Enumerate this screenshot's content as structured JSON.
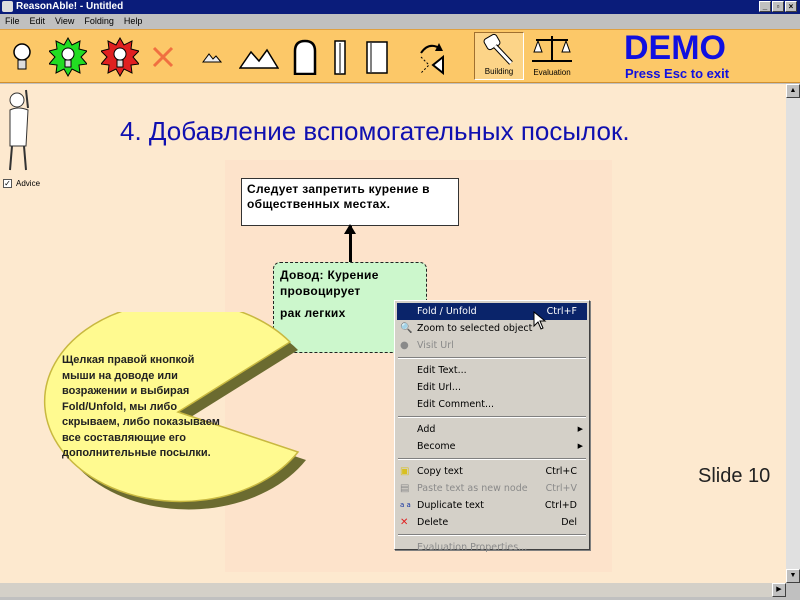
{
  "window": {
    "title": "ReasonAble! - Untitled",
    "buttons": [
      "_",
      "▫",
      "×"
    ]
  },
  "menubar": [
    "File",
    "Edit",
    "View",
    "Folding",
    "Help"
  ],
  "toolbar": {
    "tools": [
      "bulb-icon",
      "bulb-green-icon",
      "bulb-red-icon",
      "delete-x-icon",
      "small-mountains-icon",
      "mountains-icon",
      "tombstone-icon",
      "pillar-icon",
      "scroll-icon",
      "rotate-icon"
    ],
    "modes": [
      {
        "label": "Building",
        "active": true
      },
      {
        "label": "Evaluation",
        "active": false
      }
    ],
    "demo": "DEMO",
    "demo_hint": "Press Esc to exit",
    "accent": "#1010e0"
  },
  "advice": {
    "label": "Advice",
    "checked": true,
    "check": "✓"
  },
  "slide": {
    "title": "4. Добавление вспомогательных посылок.",
    "number": "Slide 10"
  },
  "nodes": {
    "claim": "Следует запретить курение в общественных местах.",
    "reason_line1": "Довод: Курение провоцирует",
    "reason_line2": "рак легких"
  },
  "callout": "Щелкая правой кнопкой мыши на доводе или возражении и выбирая Fold/Unfold, мы либо скрываем, либо показываем все составляющие его дополнительные посылки.",
  "context_menu": {
    "fold": {
      "label": "Fold / Unfold",
      "shortcut": "Ctrl+F"
    },
    "zoom": {
      "label": "Zoom to selected object"
    },
    "visit": {
      "label": "Visit Url"
    },
    "edit_text": "Edit Text...",
    "edit_url": "Edit Url...",
    "edit_comment": "Edit Comment...",
    "add": "Add",
    "become": "Become",
    "copy": {
      "label": "Copy text",
      "shortcut": "Ctrl+C"
    },
    "paste": {
      "label": "Paste text as new node",
      "shortcut": "Ctrl+V"
    },
    "duplicate": {
      "label": "Duplicate text",
      "shortcut": "Ctrl+D"
    },
    "delete": {
      "label": "Delete",
      "shortcut": "Del"
    },
    "eval_props": "Evaluation Properties..."
  }
}
